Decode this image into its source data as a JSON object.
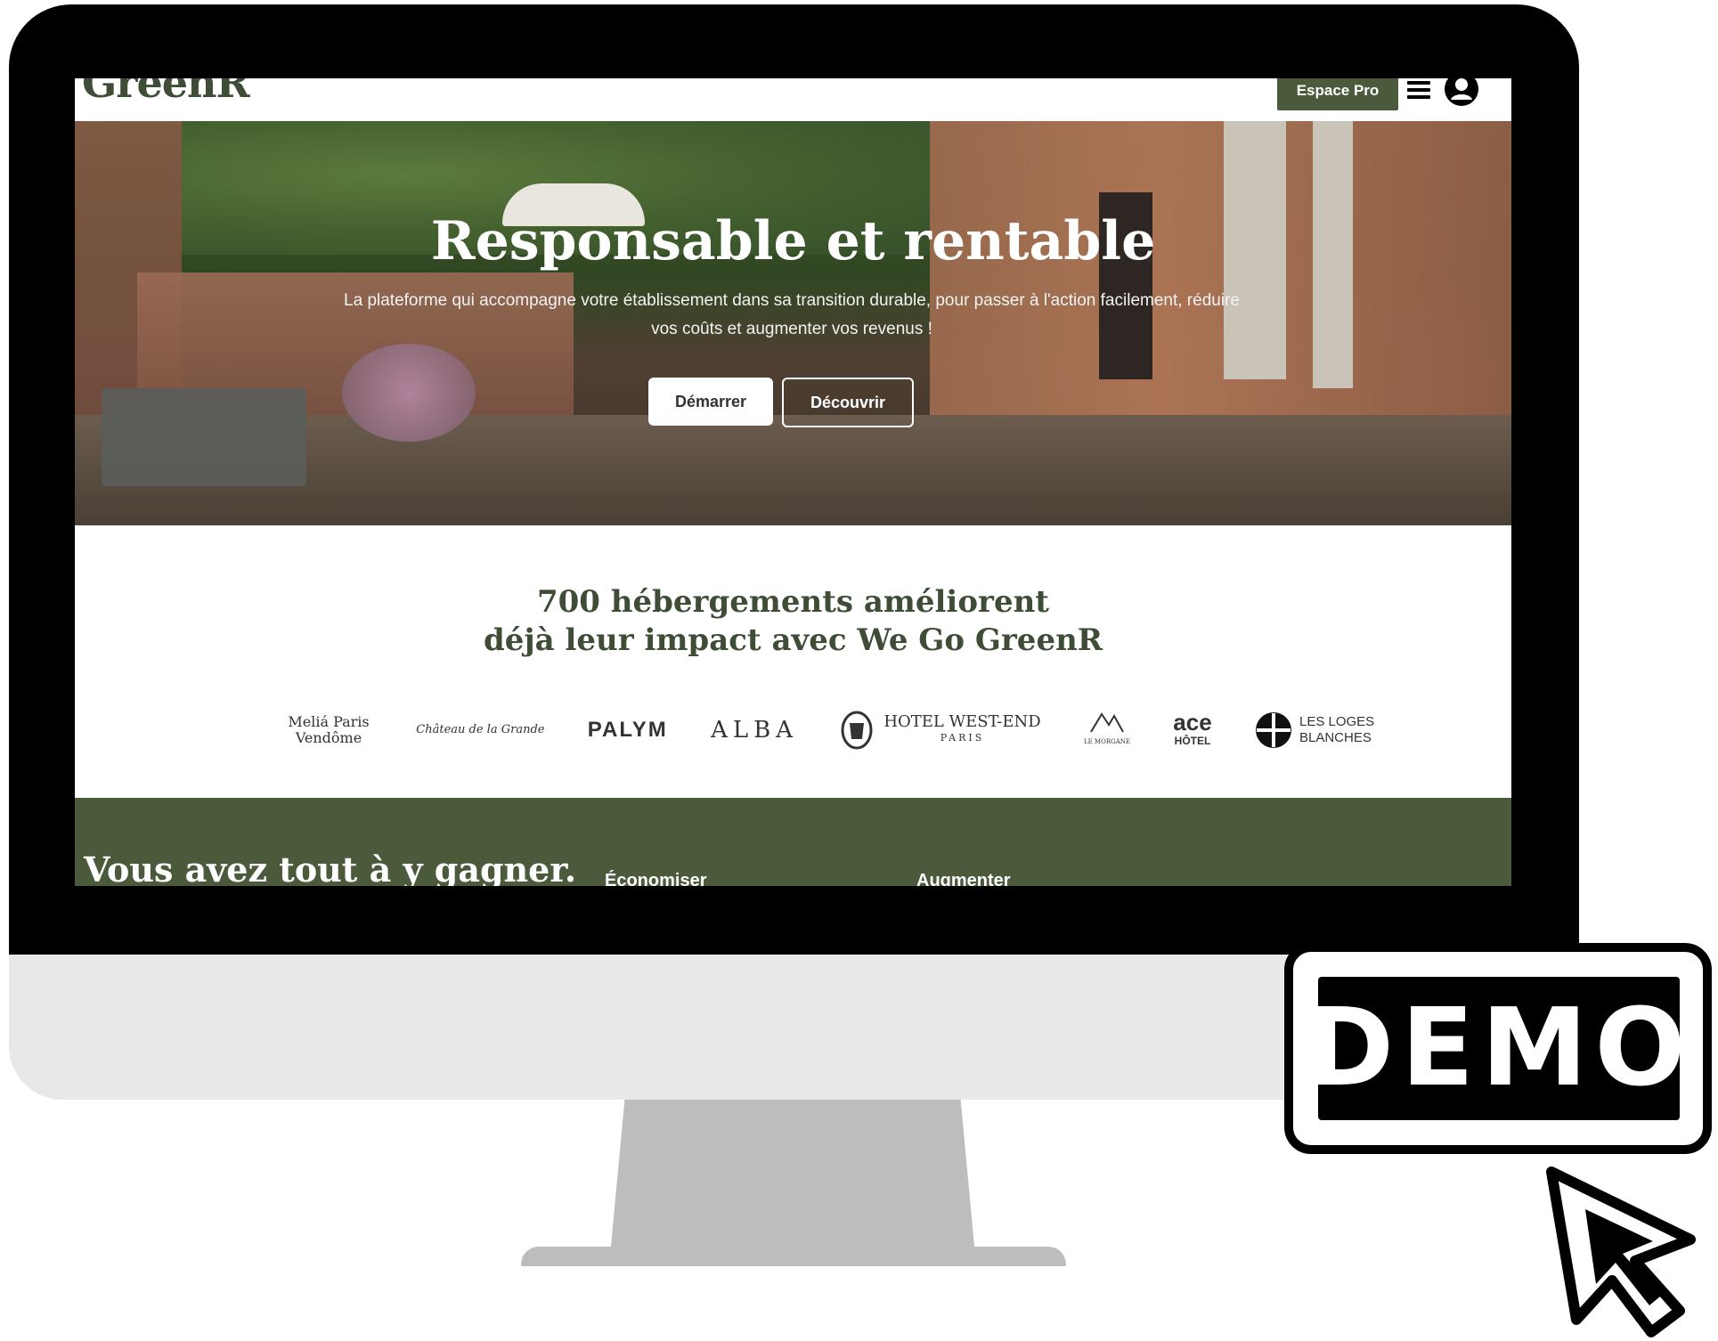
{
  "navbar": {
    "logo": "GreenR",
    "pro_button": "Espace Pro",
    "menu_icon": "menu-icon",
    "user_icon": "user-icon"
  },
  "hero": {
    "title": "Responsable et rentable",
    "subtitle": "La plateforme qui accompagne votre établissement dans sa transition durable, pour passer à l'action facilement, réduire vos coûts et augmenter vos revenus !",
    "start_button": "Démarrer",
    "discover_button": "Découvrir"
  },
  "partners": {
    "title_line1": "700 hébergements améliorent",
    "title_line2": "déjà leur impact avec We Go GreenR",
    "logos": [
      "Meliá Paris Vendôme",
      "Château de la Grande",
      "PALYM",
      "ALBA",
      "HOTEL WEST-END",
      "PARIS",
      "LE MORGANE",
      "ace",
      "HÔTEL",
      "LES LOGES BLANCHES"
    ]
  },
  "green_section": {
    "title": "Vous avez tout à y gagner.",
    "col1": "Économiser",
    "col2": "Augmenter"
  },
  "badge": {
    "label": "DEMO"
  },
  "colors": {
    "brand_green": "#4b5a3a",
    "title_green": "#3f4d37",
    "frame": "#000000",
    "chin": "#e8e8e8",
    "stand": "#bdbdbd"
  }
}
